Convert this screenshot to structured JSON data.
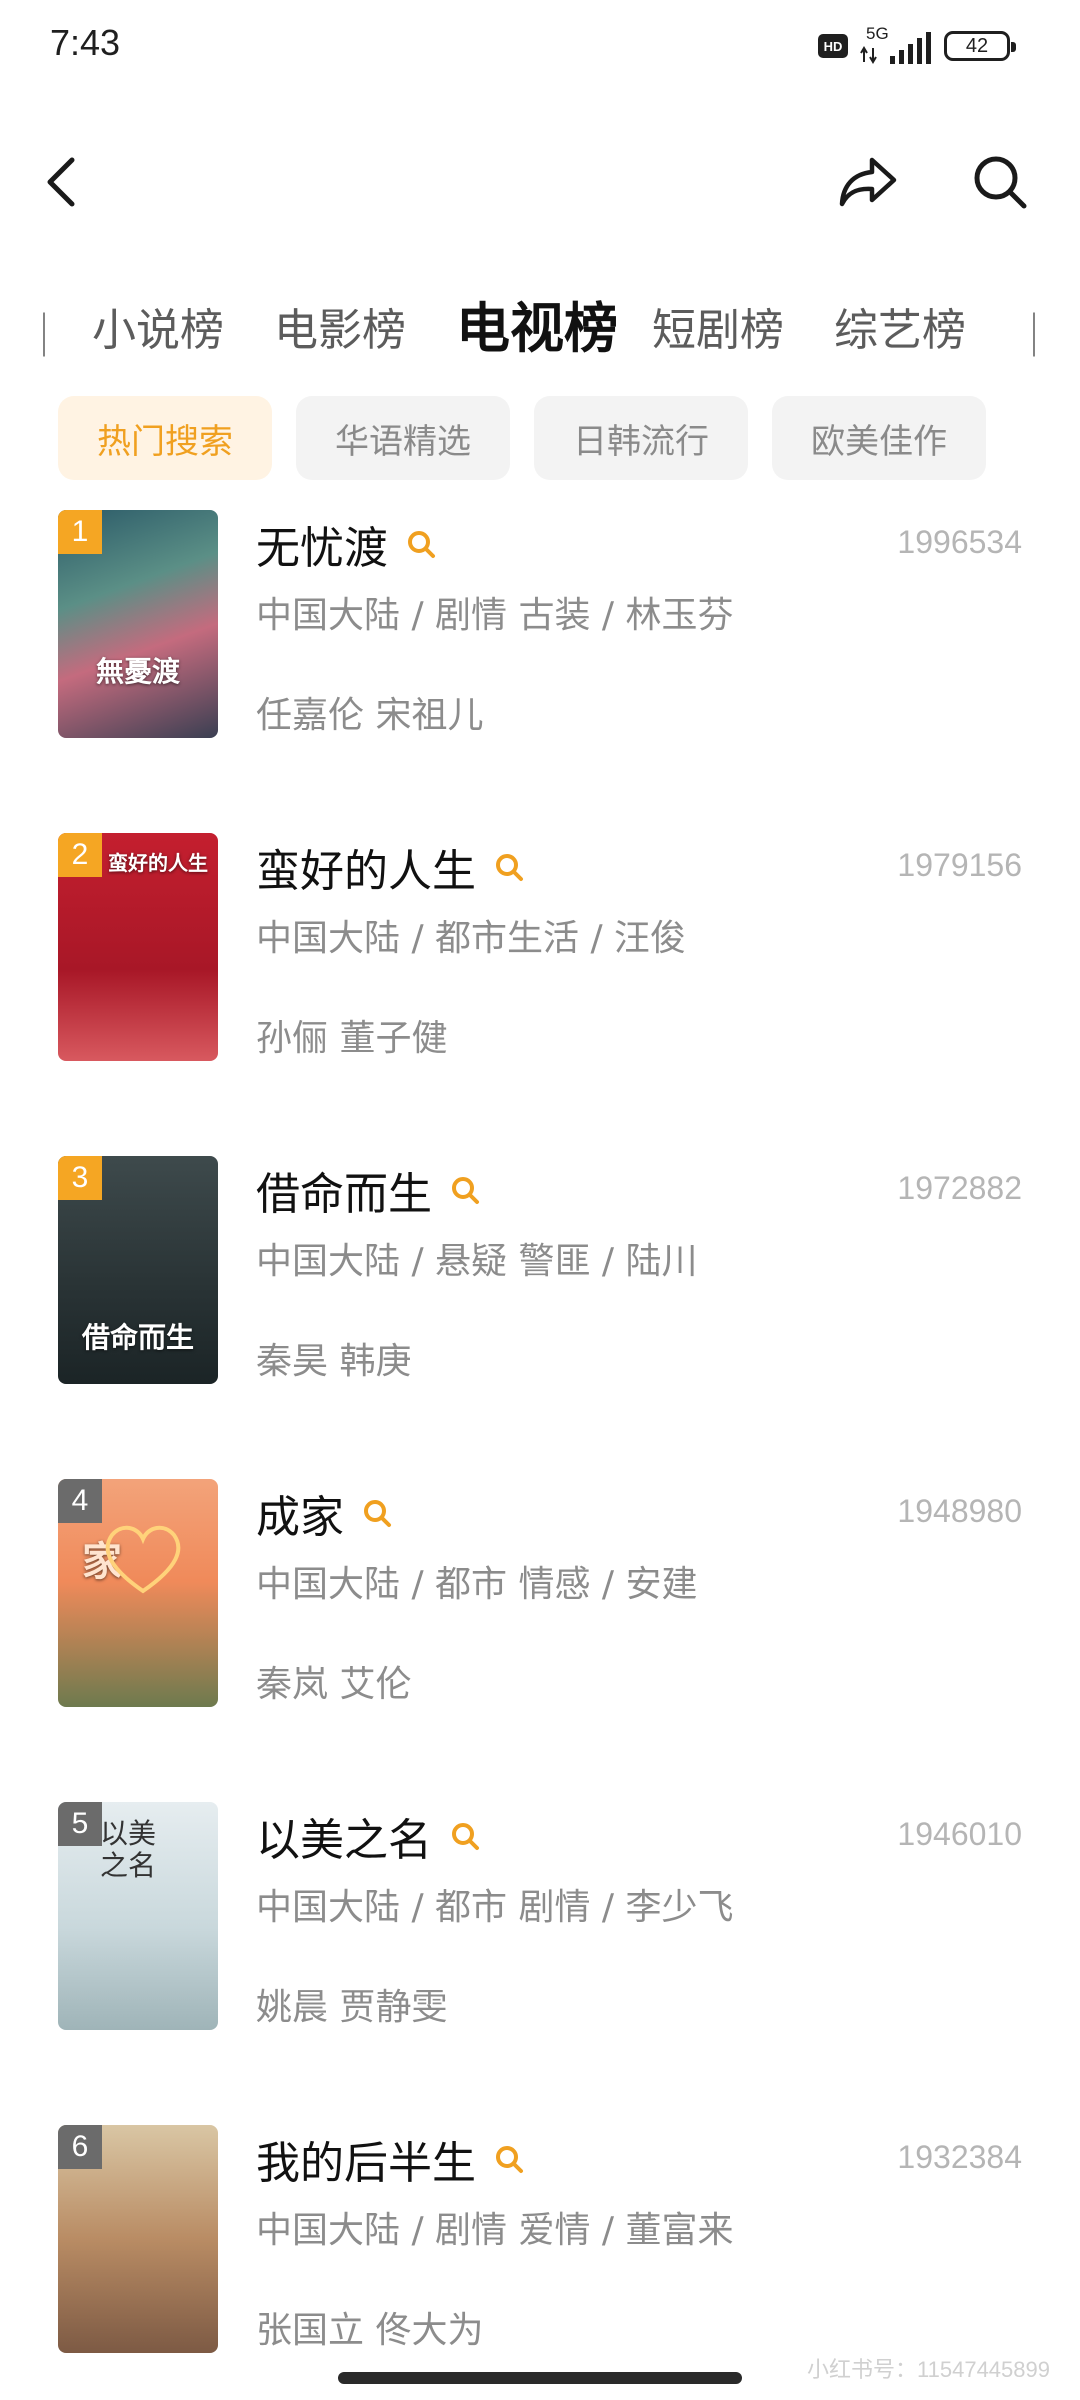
{
  "status_bar": {
    "time": "7:43",
    "hd": "HD",
    "network": "5G",
    "battery": "42"
  },
  "category_tabs": {
    "left_partial": "｜",
    "items": [
      "小说榜",
      "电影榜",
      "电视榜",
      "短剧榜",
      "综艺榜"
    ],
    "active_index": 2
  },
  "filters": {
    "items": [
      "热门搜索",
      "华语精选",
      "日韩流行",
      "欧美佳作"
    ],
    "active_index": 0,
    "active_bg": "#fff3e3",
    "active_color": "#f0a020"
  },
  "rankings": [
    {
      "rank": "1",
      "title": "无忧渡",
      "score": "1996534",
      "meta": "中国大陆 / 剧情 古装 / 林玉芬",
      "cast": "任嘉伦 宋祖儿",
      "poster_text": "無憂渡",
      "badge_color": "#f5a623"
    },
    {
      "rank": "2",
      "title": "蛮好的人生",
      "score": "1979156",
      "meta": "中国大陆 / 都市生活 / 汪俊",
      "cast": "孙俪 董子健",
      "poster_text": "蛮好的人生",
      "badge_color": "#f5a623"
    },
    {
      "rank": "3",
      "title": "借命而生",
      "score": "1972882",
      "meta": "中国大陆 / 悬疑 警匪 / 陆川",
      "cast": "秦昊 韩庚",
      "poster_text": "借命而生",
      "badge_color": "#f5a623"
    },
    {
      "rank": "4",
      "title": "成家",
      "score": "1948980",
      "meta": "中国大陆 / 都市 情感 / 安建",
      "cast": "秦岚 艾伦",
      "poster_text": "家",
      "badge_color": "#6b6b6b"
    },
    {
      "rank": "5",
      "title": "以美之名",
      "score": "1946010",
      "meta": "中国大陆 / 都市 剧情 / 李少飞",
      "cast": "姚晨 贾静雯",
      "poster_text": "以美之名",
      "badge_color": "#6b6b6b"
    },
    {
      "rank": "6",
      "title": "我的后半生",
      "score": "1932384",
      "meta": "中国大陆 / 剧情 爱情 / 董富来",
      "cast": "张国立 佟大为",
      "poster_text": "",
      "badge_color": "#6b6b6b"
    }
  ],
  "watermark": "小红书号：11547445899"
}
